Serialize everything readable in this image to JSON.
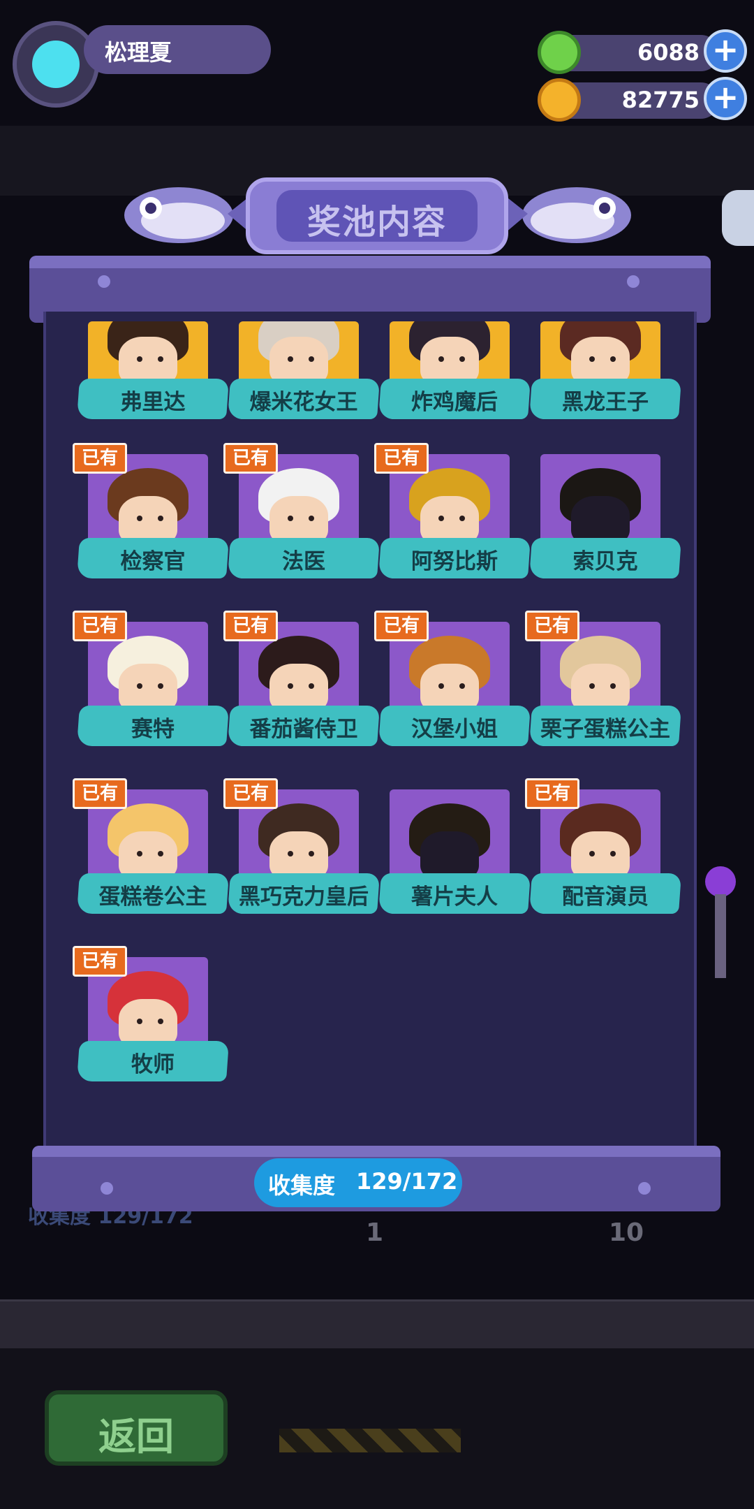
{
  "player": {
    "name": "松理夏"
  },
  "currencies": [
    {
      "icon": "green-token-icon",
      "value": "6088",
      "color": "#6fd14a"
    },
    {
      "icon": "gold-planet-coin-icon",
      "value": "82775",
      "color": "#f4b22b"
    }
  ],
  "pool": {
    "title": "奖池内容",
    "owned_badge": "已有",
    "collection_label": "收集度",
    "collection_value": "129/172",
    "rows": [
      [
        {
          "name": "弗里达",
          "owned": false,
          "bg": "gold",
          "hair": "#3a2418"
        },
        {
          "name": "爆米花女王",
          "owned": false,
          "bg": "gold",
          "hair": "#d9cfc4"
        },
        {
          "name": "炸鸡魔后",
          "owned": false,
          "bg": "gold",
          "hair": "#2c2230"
        },
        {
          "name": "黑龙王子",
          "owned": false,
          "bg": "gold",
          "hair": "#5b2a22"
        }
      ],
      [
        {
          "name": "检察官",
          "owned": true,
          "bg": "purple",
          "hair": "#6b3a1e"
        },
        {
          "name": "法医",
          "owned": true,
          "bg": "purple",
          "hair": "#f2f2f2"
        },
        {
          "name": "阿努比斯",
          "owned": true,
          "bg": "purple",
          "hair": "#d8a21e"
        },
        {
          "name": "索贝克",
          "owned": false,
          "bg": "purple",
          "hair": "#1b1714",
          "silhouette": true
        }
      ],
      [
        {
          "name": "赛特",
          "owned": true,
          "bg": "purple",
          "hair": "#f6f0de"
        },
        {
          "name": "番茄酱侍卫",
          "owned": true,
          "bg": "purple",
          "hair": "#2c1b1b"
        },
        {
          "name": "汉堡小姐",
          "owned": true,
          "bg": "purple",
          "hair": "#c9792a"
        },
        {
          "name": "栗子蛋糕公主",
          "owned": true,
          "bg": "purple",
          "hair": "#e2c79c"
        }
      ],
      [
        {
          "name": "蛋糕卷公主",
          "owned": true,
          "bg": "purple",
          "hair": "#f4c56a"
        },
        {
          "name": "黑巧克力皇后",
          "owned": true,
          "bg": "purple",
          "hair": "#3f2a21"
        },
        {
          "name": "薯片夫人",
          "owned": false,
          "bg": "purple",
          "hair": "#241c14",
          "silhouette": true
        },
        {
          "name": "配音演员",
          "owned": true,
          "bg": "purple",
          "hair": "#5a2a1f"
        }
      ],
      [
        {
          "name": "牧师",
          "owned": true,
          "bg": "purple",
          "hair": "#d6323a"
        }
      ]
    ]
  },
  "background": {
    "collection_dim": "收集度  129/172",
    "draw_one_count": "1",
    "draw_ten_count": "10",
    "back_label": "返回"
  }
}
